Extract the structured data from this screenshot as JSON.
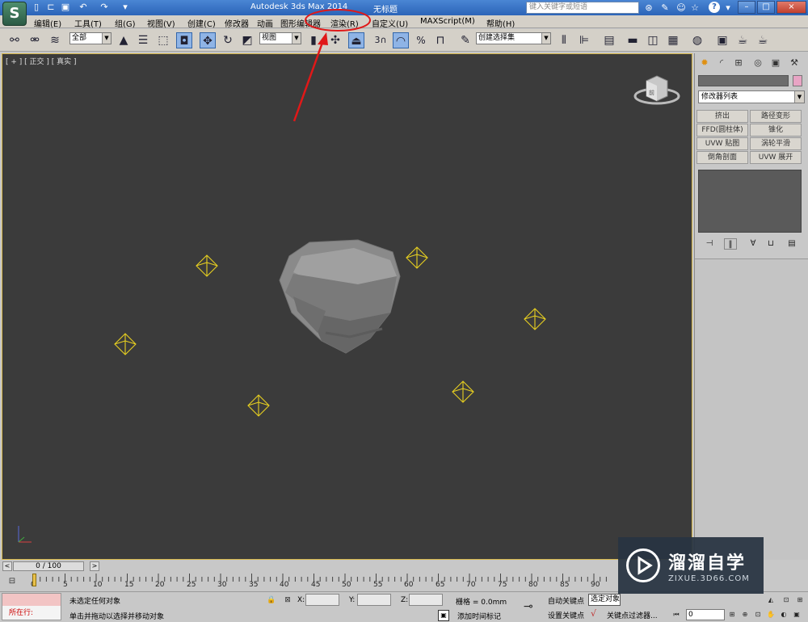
{
  "titlebar": {
    "app_title": "Autodesk 3ds Max  2014",
    "doc_name": "无标题",
    "search_placeholder": "键入关键字或短语",
    "help_icon": "?",
    "window_buttons": {
      "minimize": "–",
      "restore": "□",
      "close": "×"
    },
    "quick_access": [
      "new-file-icon",
      "open-file-icon",
      "save-file-icon",
      "undo-icon",
      "redo-icon",
      "dropdown-icon"
    ]
  },
  "menubar": {
    "items": [
      "编辑(E)",
      "工具(T)",
      "组(G)",
      "视图(V)",
      "创建(C)",
      "修改器",
      "动画",
      "图形编辑器",
      "渲染(R)",
      "自定义(U)",
      "MAXScript(M)",
      "帮助(H)"
    ]
  },
  "toolbar": {
    "selection_filter": "全部",
    "ref_coord": "视图",
    "named_selection": "创建选择集",
    "snap_label": "3",
    "percent_label": "%"
  },
  "viewport": {
    "label": "[ + ] [ 正交 ] [ 真实 ]",
    "viewcube_text": "前"
  },
  "command_panel": {
    "modifier_list": "修改器列表",
    "modifier_buttons": [
      "挤出",
      "路径变形",
      "FFD(圆柱体)",
      "锥化",
      "UVW 贴图",
      "涡轮平滑",
      "倒角剖面",
      "UVW 展开"
    ],
    "swatch_color": "#e8a4c4"
  },
  "timeline": {
    "frame_range": "0 / 100",
    "ticks": [
      "0",
      "5",
      "10",
      "15",
      "20",
      "25",
      "30",
      "35",
      "40",
      "45",
      "50",
      "55",
      "60",
      "65",
      "70",
      "75",
      "80",
      "85",
      "90"
    ]
  },
  "statusbar": {
    "listener": "所在行:",
    "status": "未选定任何对象",
    "prompt": "单击并拖动以选择并移动对象",
    "x_label": "X:",
    "y_label": "Y:",
    "z_label": "Z:",
    "grid": "栅格 = 0.0mm",
    "add_time_tag": "添加时间标记",
    "auto_key": "自动关键点",
    "set_key": "设置关键点",
    "selected_combo": "选定对象",
    "key_filters": "关键点过滤器...",
    "frame_value": "0"
  },
  "watermark": {
    "title": "溜溜自学",
    "subtitle": "ZIXUE.3D66.COM"
  },
  "colors": {
    "viewport_bg": "#3b3b3b",
    "light_gizmo": "#e8d020",
    "annotation_red": "#e01818",
    "title_blue": "#2b64b8"
  }
}
